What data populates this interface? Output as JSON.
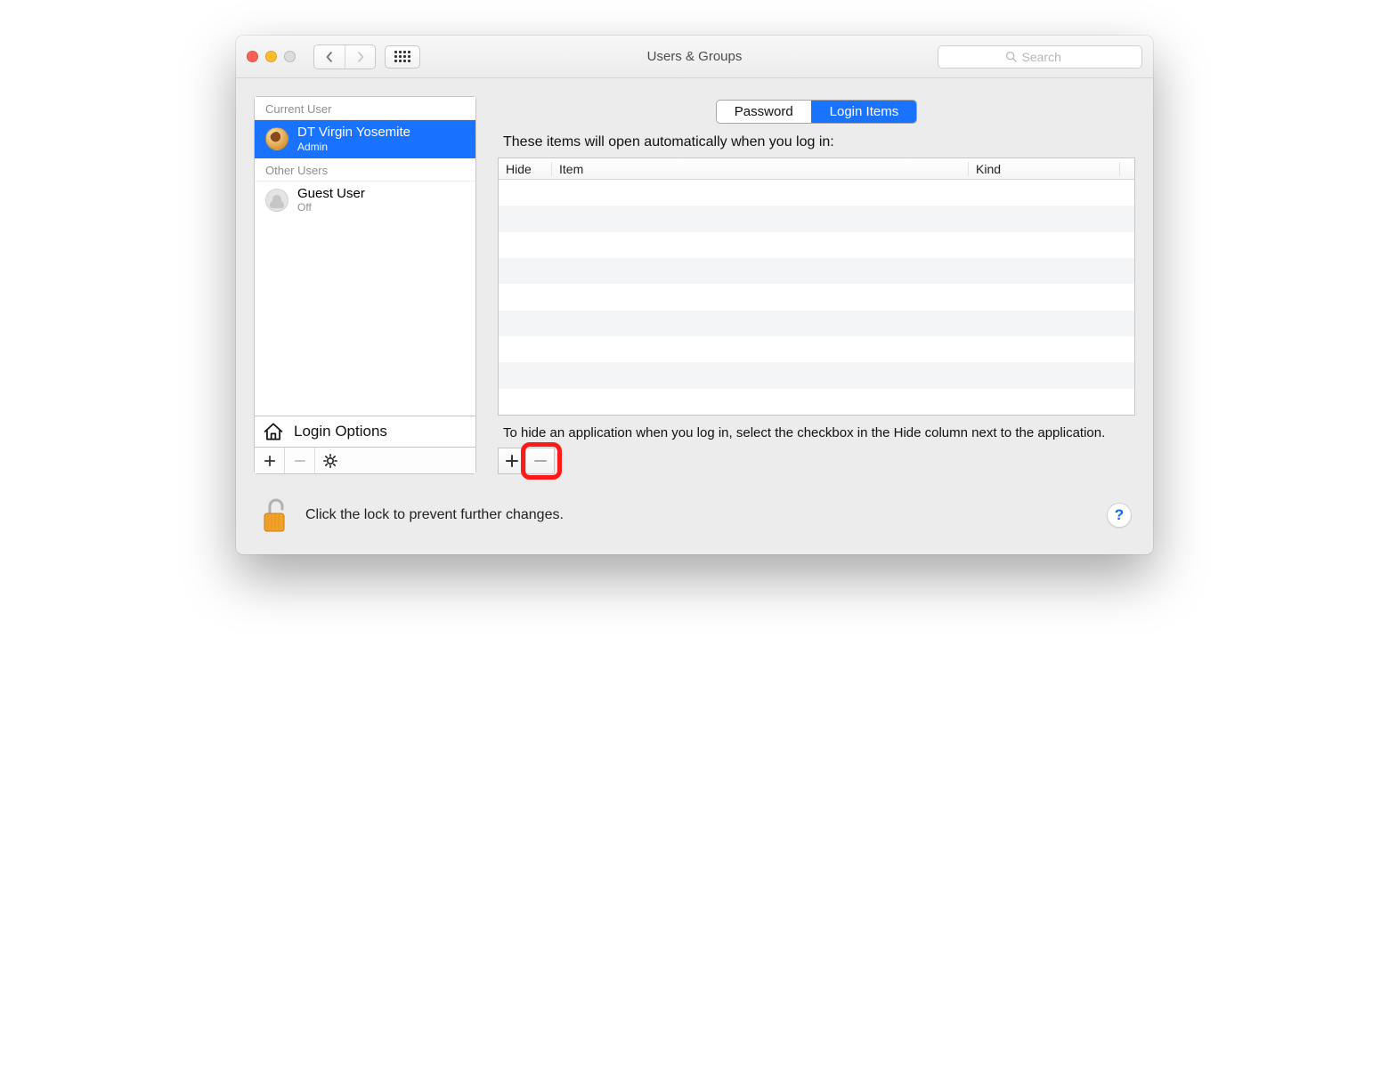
{
  "window": {
    "title": "Users & Groups",
    "search_placeholder": "Search"
  },
  "sidebar": {
    "current_user_label": "Current User",
    "other_users_label": "Other Users",
    "current_user": {
      "name": "DT Virgin Yosemite",
      "role": "Admin"
    },
    "other_users": [
      {
        "name": "Guest User",
        "role": "Off"
      }
    ],
    "login_options_label": "Login Options"
  },
  "tabs": {
    "password": "Password",
    "login_items": "Login Items",
    "active": "login_items"
  },
  "main": {
    "intro": "These items will open automatically when you log in:",
    "columns": {
      "hide": "Hide",
      "item": "Item",
      "kind": "Kind"
    },
    "rows": [],
    "hint": "To hide an application when you log in, select the checkbox in the Hide column next to the application."
  },
  "footer": {
    "lock_text": "Click the lock to prevent further changes.",
    "help_label": "?"
  }
}
